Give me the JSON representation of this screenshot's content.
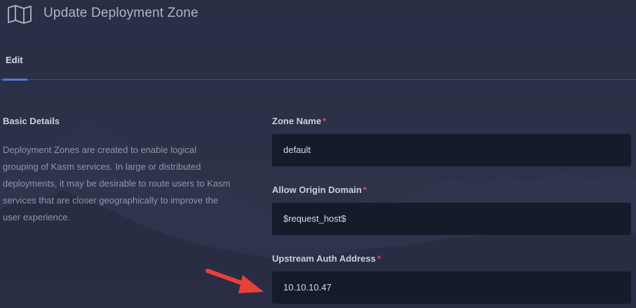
{
  "header": {
    "title": "Update Deployment Zone",
    "icon": "map-icon"
  },
  "tabs": [
    {
      "label": "Edit",
      "active": true
    }
  ],
  "section": {
    "title": "Basic Details",
    "description": "Deployment Zones are created to enable logical grouping of Kasm services. In large or distributed deployments, it may be desirable to route users to Kasm services that are closer geographically to improve the user experience."
  },
  "form": {
    "zone_name": {
      "label": "Zone Name",
      "required_mark": "*",
      "value": "default"
    },
    "allow_origin_domain": {
      "label": "Allow Origin Domain",
      "required_mark": "*",
      "value": "$request_host$"
    },
    "upstream_auth_address": {
      "label": "Upstream Auth Address",
      "required_mark": "*",
      "value": "10.10.10.47"
    }
  },
  "colors": {
    "accent": "#4c7bd8",
    "required": "#d9476b",
    "input_bg": "#161b2c",
    "arrow": "#e8403a"
  }
}
